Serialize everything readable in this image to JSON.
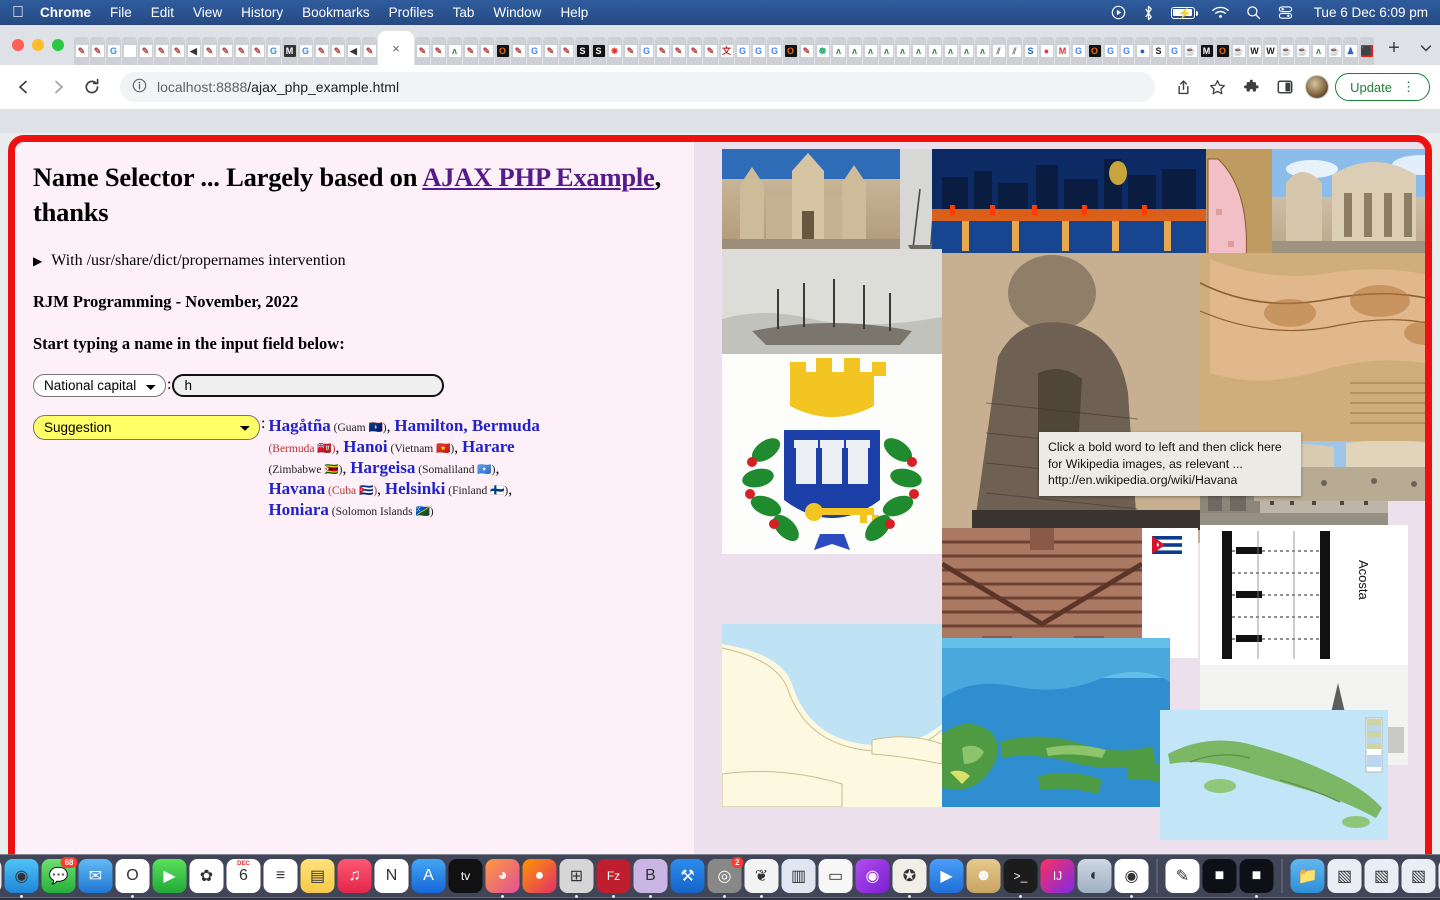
{
  "menubar": {
    "apple_icon": "apple-logo",
    "items": [
      {
        "label": "Chrome",
        "bold": true
      },
      {
        "label": "File",
        "bold": false
      },
      {
        "label": "Edit",
        "bold": false
      },
      {
        "label": "View",
        "bold": false
      },
      {
        "label": "History",
        "bold": false
      },
      {
        "label": "Bookmarks",
        "bold": false
      },
      {
        "label": "Profiles",
        "bold": false
      },
      {
        "label": "Tab",
        "bold": false
      },
      {
        "label": "Window",
        "bold": false
      },
      {
        "label": "Help",
        "bold": false
      }
    ],
    "tray_icons": [
      "screen-record-icon",
      "bluetooth-icon",
      "battery-charging-icon",
      "wifi-icon",
      "spotlight-search-icon",
      "control-center-icon"
    ],
    "clock": "Tue 6 Dec  6:09 pm"
  },
  "browser": {
    "traffic_lights": [
      "close-red",
      "minimize-yellow",
      "zoom-green"
    ],
    "active_tab_close_label": "×",
    "new_tab_label": "+",
    "tab_search_label": "⌄",
    "back_label": "←",
    "forward_label": "→",
    "reload_label": "↻",
    "site_info_label": "ⓘ",
    "url_host": "localhost:8888",
    "url_path": "/ajax_php_example.html",
    "share_label": "↑",
    "bookmark_label": "☆",
    "extensions_label": "✦",
    "sidepanel_label": "▣",
    "update_label": "Update",
    "overflow_label": "⋮",
    "accent_green": "#1a7f37",
    "tab_count_visible": 96
  },
  "page": {
    "title_part1": "Name Selector ... Largely based on ",
    "title_link": "AJAX PHP Example",
    "title_part2": ", thanks",
    "link_color": "#551a8b",
    "disclosure_triangle": "▶",
    "disclosure_text": "With /usr/share/dict/propernames intervention",
    "byline": "RJM Programming - November, 2022",
    "instruction": "Start typing a name in the input field below:",
    "type_select_value": "National capital",
    "type_select_options": [
      "National capital"
    ],
    "separator": ":",
    "name_input_value": "h",
    "name_input_placeholder": "",
    "suggestion_select_value": "Suggestion",
    "suggestion_select_options": [
      "Suggestion"
    ],
    "suggestion_select_bg": "#ffff66",
    "left_bg": "#fdf0f8",
    "right_bg": "#ece0ec",
    "frame_color": "#ee1111",
    "suggestions": [
      {
        "city": "Hagåtña",
        "country": "Guam",
        "flag": "🇬🇺",
        "style": "blue"
      },
      {
        "city": "Hamilton, Bermuda",
        "country": "Bermuda",
        "flag": "🇧🇲",
        "style": "blue-wrap"
      },
      {
        "city": "Hanoi",
        "country": "Vietnam",
        "flag": "🇻🇳",
        "style": "blue"
      },
      {
        "city": "Harare",
        "country": "Zimbabwe",
        "flag": "🇿🇼",
        "style": "blue"
      },
      {
        "city": "Hargeisa",
        "country": "Somaliland",
        "flag": "🇸🇴",
        "style": "blue"
      },
      {
        "city": "Havana",
        "country": "Cuba",
        "flag": "🇨🇺",
        "style": "blue-red-country"
      },
      {
        "city": "Helsinki",
        "country": "Finland",
        "flag": "🇫🇮",
        "style": "blue"
      },
      {
        "city": "Honiara",
        "country": "Solomon Islands",
        "flag": "🇸🇧",
        "style": "blue"
      }
    ],
    "tooltip_text": "Click a bold word to left and then click here for Wikipedia images, as relevant ... http://en.wikipedia.org/wiki/Havana",
    "mosaic_vertical_label": "Acosta"
  },
  "dock": {
    "items": [
      {
        "name": "finder",
        "glyph": "☺",
        "running": true
      },
      {
        "name": "launchpad",
        "glyph": "∷",
        "running": false
      },
      {
        "name": "safari",
        "glyph": "◉",
        "running": true
      },
      {
        "name": "messages",
        "glyph": "💬",
        "running": false,
        "badge": "68"
      },
      {
        "name": "mail",
        "glyph": "✉",
        "running": false
      },
      {
        "name": "opera",
        "glyph": "O",
        "running": true
      },
      {
        "name": "facetime",
        "glyph": "▶",
        "running": false
      },
      {
        "name": "photos",
        "glyph": "✿",
        "running": false
      },
      {
        "name": "calendar",
        "glyph": "6",
        "running": false,
        "sublabel": "DEC"
      },
      {
        "name": "reminders",
        "glyph": "≡",
        "running": false
      },
      {
        "name": "notes",
        "glyph": "▤",
        "running": false
      },
      {
        "name": "music",
        "glyph": "♫",
        "running": false
      },
      {
        "name": "news",
        "glyph": "N",
        "running": false
      },
      {
        "name": "app-store",
        "glyph": "A",
        "running": false
      },
      {
        "name": "apple-tv",
        "glyph": "tv",
        "running": false
      },
      {
        "name": "podcasts-art",
        "glyph": "◕",
        "running": true
      },
      {
        "name": "firefox",
        "glyph": "●",
        "running": false
      },
      {
        "name": "calculator",
        "glyph": "⊞",
        "running": true
      },
      {
        "name": "filezilla",
        "glyph": "Fz",
        "running": true
      },
      {
        "name": "bbedit",
        "glyph": "B",
        "running": true
      },
      {
        "name": "xcode",
        "glyph": "⚒",
        "running": false
      },
      {
        "name": "safari-tech-preview",
        "glyph": "◎",
        "running": true,
        "badge": "2"
      },
      {
        "name": "mamp",
        "glyph": "❦",
        "running": true
      },
      {
        "name": "screen-sharing",
        "glyph": "▥",
        "running": false
      },
      {
        "name": "pages",
        "glyph": "▭",
        "running": false
      },
      {
        "name": "podcasts",
        "glyph": "◉",
        "running": false
      },
      {
        "name": "gimp",
        "glyph": "✪",
        "running": true
      },
      {
        "name": "zoom",
        "glyph": "▶",
        "running": false
      },
      {
        "name": "contacts",
        "glyph": "☻",
        "running": false
      },
      {
        "name": "terminal",
        "glyph": ">_",
        "running": true
      },
      {
        "name": "intellij-idea",
        "glyph": "IJ",
        "running": false
      },
      {
        "name": "preview",
        "glyph": "◐",
        "running": false
      },
      {
        "name": "chrome",
        "glyph": "◉",
        "running": true
      },
      {
        "name": "textedit",
        "glyph": "✎",
        "running": false
      },
      {
        "name": "terminal-window-1",
        "glyph": "■",
        "running": false
      },
      {
        "name": "terminal-window-2",
        "glyph": "■",
        "running": true
      },
      {
        "name": "downloads-folder",
        "glyph": "📁",
        "running": false
      },
      {
        "name": "minimized-window-1",
        "glyph": "▧",
        "running": false
      },
      {
        "name": "minimized-window-2",
        "glyph": "▧",
        "running": false
      },
      {
        "name": "minimized-window-3",
        "glyph": "▧",
        "running": false
      },
      {
        "name": "minimized-window-4",
        "glyph": "▨",
        "running": false
      },
      {
        "name": "trash",
        "glyph": "🗑",
        "running": false
      }
    ]
  }
}
